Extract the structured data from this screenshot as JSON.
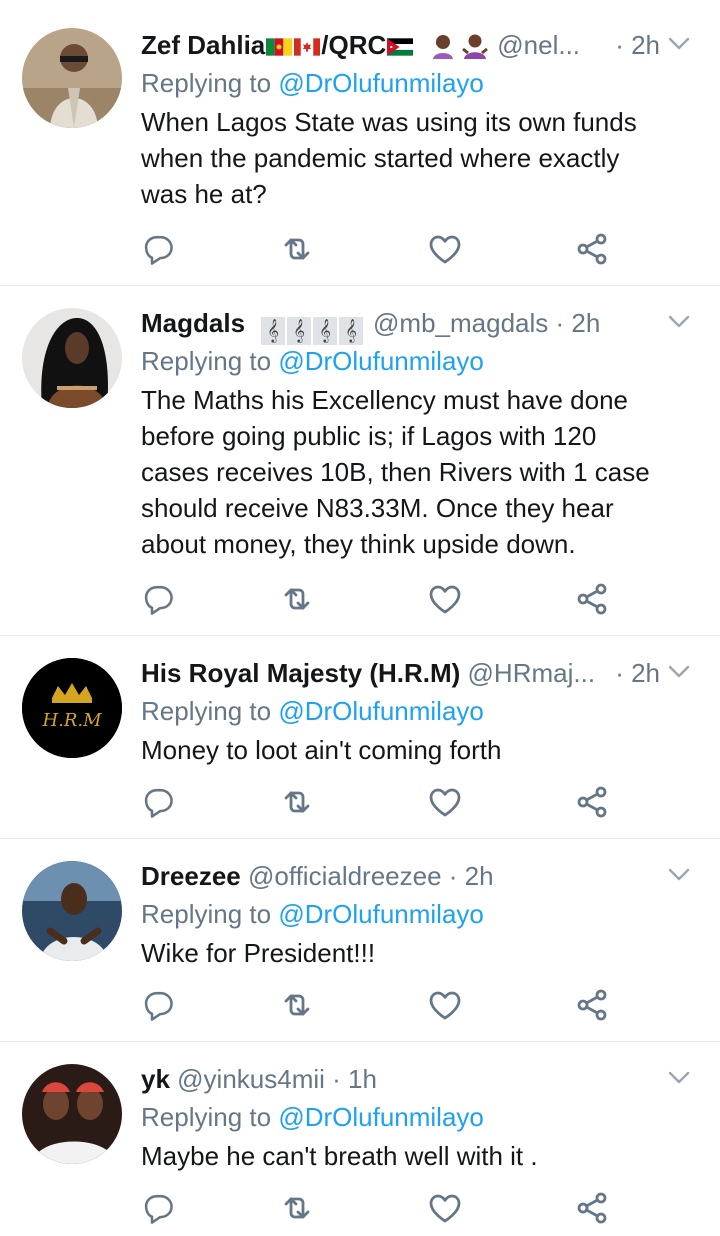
{
  "tweets": [
    {
      "name": "Zef Dahlia",
      "name_suffix": "/QRC",
      "handle": "@nel...",
      "time": "· 2h",
      "replying_label": "Replying to",
      "mention": "@DrOlufunmilayo",
      "text": "When Lagos State was using its own funds\nwhen the pandemic started where exactly\nwas he at?"
    },
    {
      "name": "Magdals",
      "handle": "@mb_magdals",
      "time": "· 2h",
      "replying_label": "Replying to",
      "mention": "@DrOlufunmilayo",
      "text": "The Maths his Excellency must have done\nbefore going public is; if Lagos with 120\ncases receives 10B, then Rivers with 1 case\nshould receive N83.33M. Once they hear\nabout money, they think upside down."
    },
    {
      "name": "His Royal Majesty (H.R.M)",
      "handle": "@HRmaj...",
      "time": "· 2h",
      "replying_label": "Replying to",
      "mention": "@DrOlufunmilayo",
      "avatar_text": "H.R.M",
      "text": "Money to loot ain't coming forth"
    },
    {
      "name": "Dreezee",
      "handle": "@officialdreezee",
      "time": "· 2h",
      "replying_label": "Replying to",
      "mention": "@DrOlufunmilayo",
      "text": "Wike for President!!!"
    },
    {
      "name": "yk",
      "handle": "@yinkus4mii",
      "time": "· 1h",
      "replying_label": "Replying to",
      "mention": "@DrOlufunmilayo",
      "text": "Maybe he can't breath well with it ."
    }
  ],
  "colors": {
    "link": "#1da1f2",
    "muted": "#657786",
    "icon": "#657786",
    "divider": "#e6ecf0"
  }
}
